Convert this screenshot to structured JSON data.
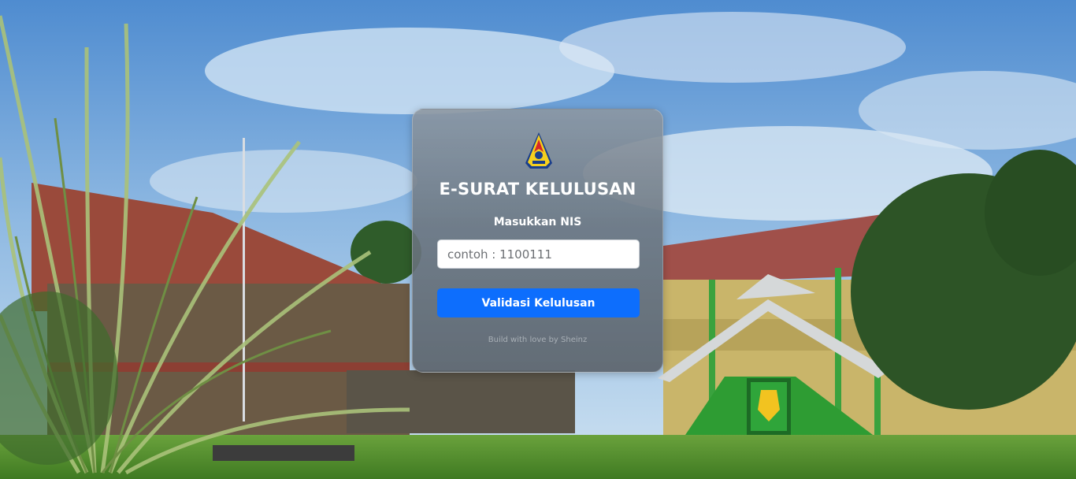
{
  "background": {
    "description_icon": "school-building-photo",
    "colors": {
      "sky": "#6fa3d8",
      "grass": "#4f8d2f",
      "roof": "#9c4a3c",
      "building_green": "#2fa53a"
    }
  },
  "card": {
    "logo_icon": "school-emblem-icon",
    "title": "E-SURAT KELULUSAN",
    "input_label": "Masukkan NIS",
    "input": {
      "placeholder": "contoh : 1100111",
      "value": ""
    },
    "submit_label": "Validasi Kelulusan",
    "footer_text": "Build with love by Sheinz",
    "colors": {
      "button": "#0d6efd",
      "text": "#ffffff"
    }
  }
}
